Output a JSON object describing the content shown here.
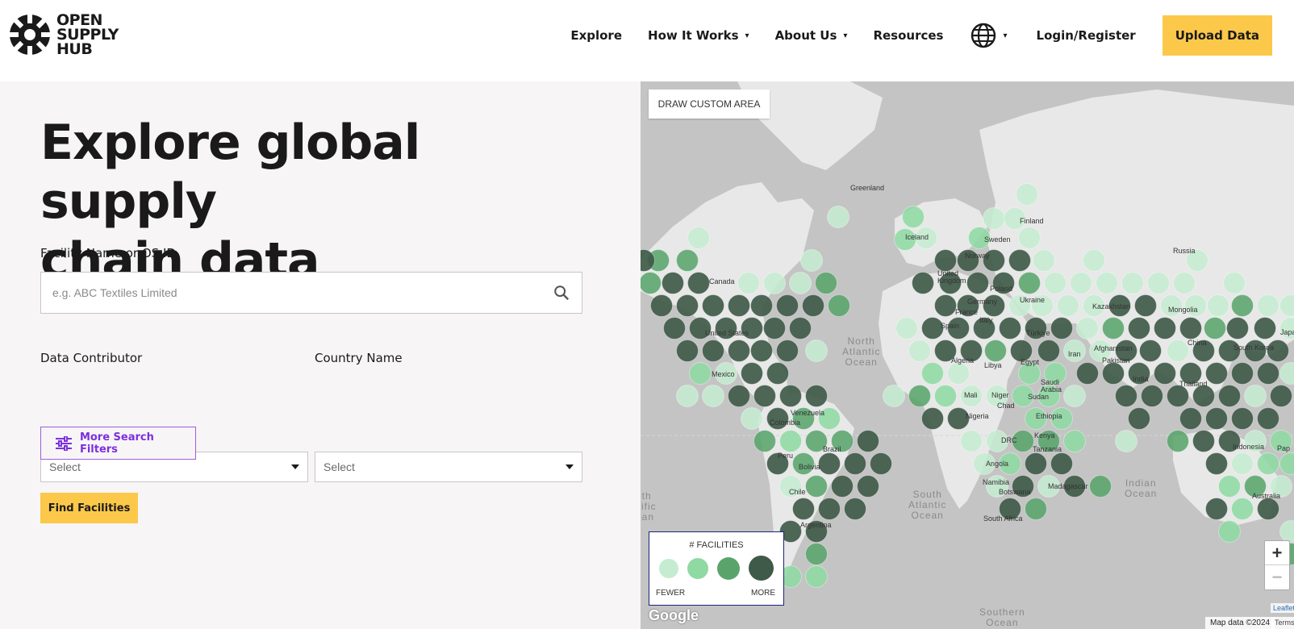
{
  "header": {
    "logo_text": [
      "OPEN",
      "SUPPLY",
      "HUB"
    ],
    "nav": {
      "explore": "Explore",
      "how_it_works": "How It Works",
      "about_us": "About Us",
      "resources": "Resources",
      "login": "Login/Register",
      "upload": "Upload Data"
    },
    "icons": {
      "language": "globe-icon",
      "dropdown": "chevron-down-icon"
    }
  },
  "main": {
    "title_line1": "Explore global supply",
    "title_line2": "chain data",
    "facility_label": "Facility Name or OS ID",
    "facility_placeholder": "e.g. ABC Textiles Limited",
    "contributor_label": "Data Contributor",
    "contributor_value": "Select",
    "country_label": "Country Name",
    "country_value": "Select",
    "more_filters": "More Search Filters",
    "find_button": "Find Facilities"
  },
  "map": {
    "draw_button": "DRAW CUSTOM AREA",
    "legend_title": "# FACILITIES",
    "legend_fewer": "FEWER",
    "legend_more": "MORE",
    "legend_colors": [
      "#c5ecd0",
      "#8fd9a3",
      "#5aa46c",
      "#3f5a48"
    ],
    "zoom_in": "+",
    "zoom_out": "−",
    "google": "Google",
    "map_data": "Map data ©2024",
    "terms": "Terms",
    "leaflet": "Leaflet",
    "places": {
      "greenland": "Greenland",
      "russia": "Russia",
      "canada": "Canada",
      "united_states": "United States",
      "mexico": "Mexico",
      "venezuela": "Venezuela",
      "colombia": "Colombia",
      "peru": "Peru",
      "brazil": "Brazil",
      "bolivia": "Bolivia",
      "chile": "Chile",
      "argentina": "Argentina",
      "iceland": "Iceland",
      "sweden": "Sweden",
      "finland": "Finland",
      "norway": "Norway",
      "united_kingdom": "United Kingdom",
      "poland": "Poland",
      "germany": "Germany",
      "ukraine": "Ukraine",
      "france": "France",
      "italy": "Italy",
      "spain": "Spain",
      "turkiye": "Türkiye",
      "kazakhstan": "Kazakhstan",
      "mongolia": "Mongolia",
      "china": "China",
      "south_korea": "South Korea",
      "japan": "Japan",
      "afghanistan": "Afghanistan",
      "pakistan": "Pakistan",
      "iran": "Iran",
      "algeria": "Algeria",
      "libya": "Libya",
      "egypt": "Egypt",
      "saudi_arabia": "Saudi Arabia",
      "india": "India",
      "thailand": "Thailand",
      "mali": "Mali",
      "niger": "Niger",
      "chad": "Chad",
      "sudan": "Sudan",
      "nigeria": "Nigeria",
      "ethiopia": "Ethiopia",
      "kenya": "Kenya",
      "drc": "DRC",
      "tanzania": "Tanzania",
      "angola": "Angola",
      "namibia": "Namibia",
      "botswana": "Botswana",
      "madagascar": "Madagascar",
      "south_africa": "South Africa",
      "indonesia": "Indonesia",
      "australia": "Australia",
      "papua": "Pap"
    },
    "oceans": {
      "north_atlantic": "North\nAtlantic\nOcean",
      "south_atlantic": "South\nAtlantic\nOcean",
      "indian": "Indian\nOcean",
      "south_pacific": "uth\ncific\nean",
      "southern": "Southern\nOcean"
    }
  }
}
